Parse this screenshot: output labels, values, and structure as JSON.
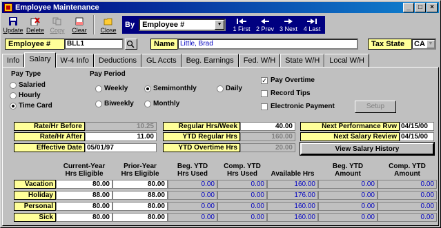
{
  "window": {
    "title": "Employee Maintenance"
  },
  "toolbar": {
    "update": "Update",
    "delete": "Delete",
    "copy": "Copy",
    "clear": "Clear",
    "close": "Close",
    "by_label": "By",
    "by_value": "Employee #",
    "first": "1 First",
    "prev": "2 Prev",
    "next": "3 Next",
    "last": "4 Last"
  },
  "header": {
    "employee_label": "Employee #",
    "employee_value": "BLL1",
    "name_label": "Name",
    "name_value": "Little, Brad",
    "tax_state_label": "Tax State",
    "tax_state_value": "CA"
  },
  "tabs": [
    "Info",
    "Salary",
    "W-4 Info",
    "Deductions",
    "GL Accts",
    "Beg. Earnings",
    "Fed. W/H",
    "State W/H",
    "Local W/H"
  ],
  "pay_type": {
    "label": "Pay Type",
    "options": [
      "Salaried",
      "Hourly",
      "Time Card"
    ],
    "selected": 2
  },
  "pay_period": {
    "label": "Pay Period",
    "options": [
      "Weekly",
      "Semimonthly",
      "Daily",
      "Biweekly",
      "Monthly"
    ],
    "selected": 1
  },
  "options": {
    "pay_overtime": "Pay Overtime",
    "record_tips": "Record Tips",
    "electronic_payment": "Electronic Payment",
    "setup": "Setup",
    "pay_overtime_checked": true,
    "record_tips_checked": false,
    "electronic_payment_checked": false
  },
  "rates": {
    "rate_before_label": "Rate/Hr Before",
    "rate_before": "10.25",
    "rate_after_label": "Rate/Hr After",
    "rate_after": "11.00",
    "effective_label": "Effective Date",
    "effective": "05/01/97",
    "regular_week_label": "Regular Hrs/Week",
    "regular_week": "40.00",
    "ytd_regular_label": "YTD Regular Hrs",
    "ytd_regular": "160.00",
    "ytd_overtime_label": "YTD Overtime Hrs",
    "ytd_overtime": "20.00",
    "next_perf_label": "Next Performance Rvw",
    "next_perf": "04/15/00",
    "next_salary_label": "Next Salary Review",
    "next_salary": "04/15/00",
    "history_button": "View Salary History"
  },
  "grid": {
    "headers": [
      [
        "Current-Year",
        "Hrs Eligible"
      ],
      [
        "Prior-Year",
        "Hrs Eligible"
      ],
      [
        "Beg. YTD",
        "Hrs Used"
      ],
      [
        "Comp. YTD",
        "Hrs Used"
      ],
      [
        "",
        "Available Hrs"
      ],
      [
        "Beg. YTD",
        "Amount"
      ],
      [
        "Comp. YTD",
        "Amount"
      ]
    ],
    "rows": [
      {
        "label": "Vacation",
        "values": [
          "80.00",
          "80.00",
          "0.00",
          "0.00",
          "160.00",
          "0.00",
          "0.00"
        ]
      },
      {
        "label": "Holiday",
        "values": [
          "88.00",
          "88.00",
          "0.00",
          "0.00",
          "176.00",
          "0.00",
          "0.00"
        ]
      },
      {
        "label": "Personal",
        "values": [
          "80.00",
          "80.00",
          "0.00",
          "0.00",
          "160.00",
          "0.00",
          "0.00"
        ]
      },
      {
        "label": "Sick",
        "values": [
          "80.00",
          "80.00",
          "0.00",
          "0.00",
          "160.00",
          "0.00",
          "0.00"
        ]
      }
    ]
  }
}
